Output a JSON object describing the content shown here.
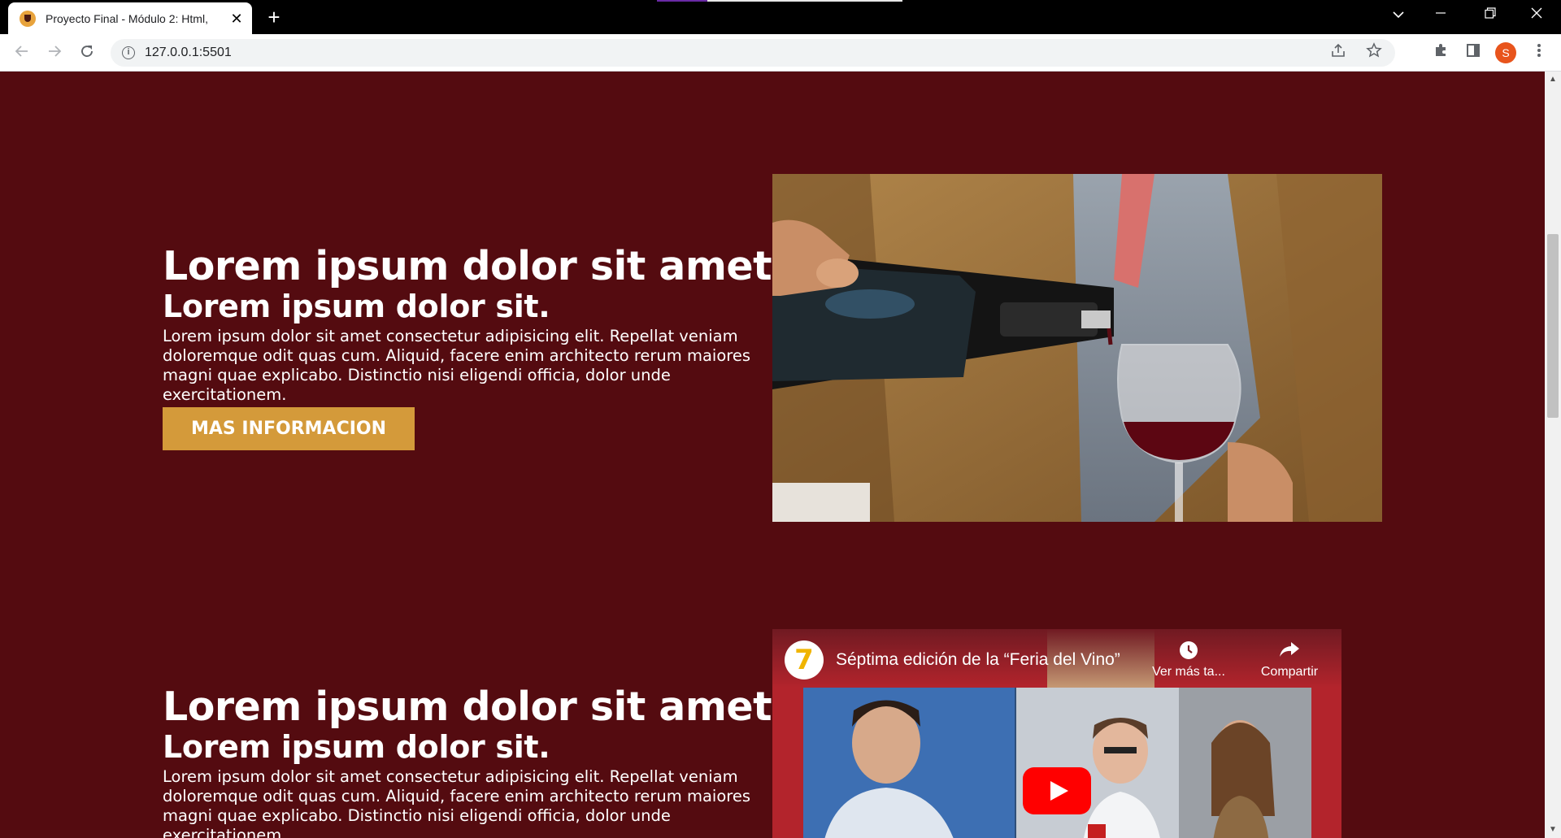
{
  "browser": {
    "tab_title": "Proyecto Final - Módulo 2: Html,",
    "tab_close": "✕",
    "new_tab": "+",
    "url": "127.0.0.1:5501",
    "profile_initial": "S",
    "icons": {
      "back": "back-arrow-icon",
      "forward": "forward-arrow-icon",
      "reload": "reload-icon",
      "site_info": "info-icon",
      "share": "share-icon",
      "bookmark": "star-icon",
      "extensions": "puzzle-icon",
      "side_panel": "side-panel-icon",
      "menu": "kebab-menu-icon",
      "tab_search": "chevron-down-icon",
      "minimize": "minimize-icon",
      "restore": "restore-icon",
      "close": "close-icon"
    }
  },
  "sections": [
    {
      "heading": "Lorem ipsum dolor sit amet.",
      "subheading": "Lorem ipsum dolor sit.",
      "paragraph": "Lorem ipsum dolor sit amet consectetur adipisicing elit. Repellat veniam doloremque odit quas cum. Aliquid, facere enim architecto rerum maiores magni quae explicabo. Distinctio nisi eligendi officia, dolor unde exercitationem.",
      "button_label": "MAS INFORMACION",
      "media": "wine-pouring-photo"
    },
    {
      "heading": "Lorem ipsum dolor sit amet.",
      "subheading": "Lorem ipsum dolor sit.",
      "paragraph": "Lorem ipsum dolor sit amet consectetur adipisicing elit. Repellat veniam doloremque odit quas cum. Aliquid, facere enim architecto rerum maiores magni quae explicabo. Distinctio nisi eligendi officia, dolor unde exercitationem.",
      "media": "youtube-embed"
    }
  ],
  "video": {
    "channel_logo_text": "7",
    "title": "Séptima edición de la “Feria del Vino”",
    "watch_later": "Ver más ta...",
    "share": "Compartir"
  },
  "colors": {
    "page_bg": "#540b10",
    "button_bg": "#d49a3a",
    "text": "#ffffff",
    "youtube_red": "#ff0000"
  }
}
